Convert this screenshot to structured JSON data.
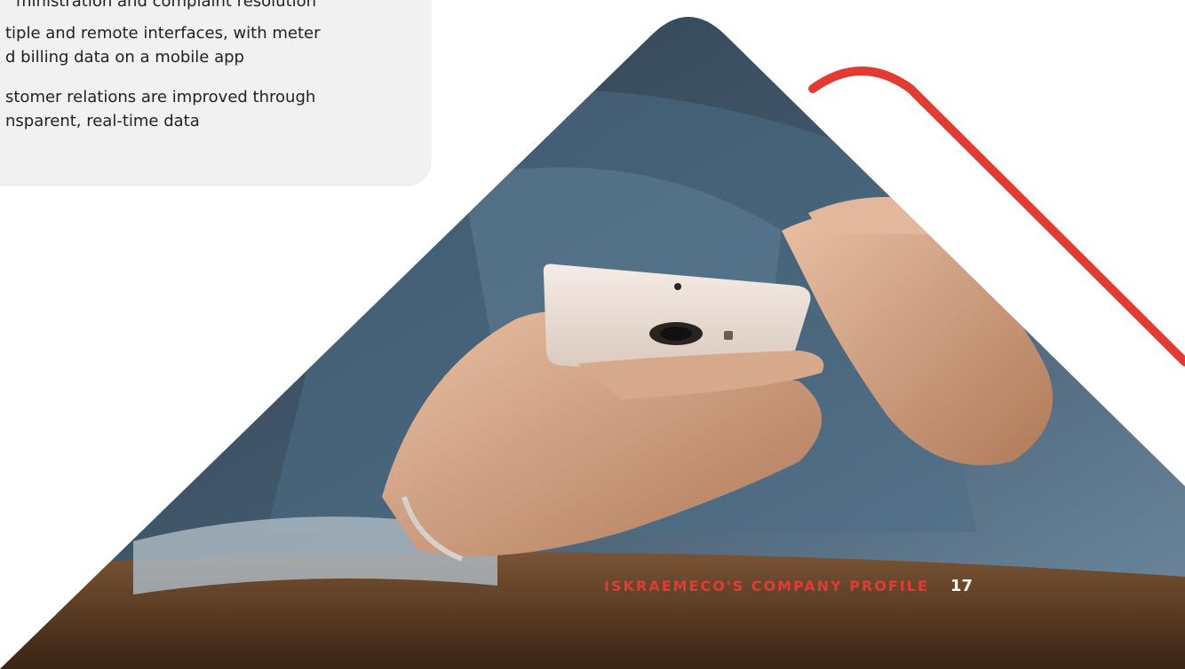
{
  "card": {
    "items": [
      {
        "lines": [
          "ministration and complaint resolution"
        ]
      },
      {
        "lines": [
          "tiple and remote interfaces, with meter",
          "d billing data on a mobile app"
        ]
      },
      {
        "lines": [
          "stomer relations are improved through",
          "nsparent, real-time data"
        ]
      }
    ]
  },
  "footer": {
    "title": "ISKRAEMECO'S COMPANY PROFILE",
    "page_number": "17"
  },
  "colors": {
    "accent": "#e23b33",
    "card_bg": "#f1f1f1"
  }
}
